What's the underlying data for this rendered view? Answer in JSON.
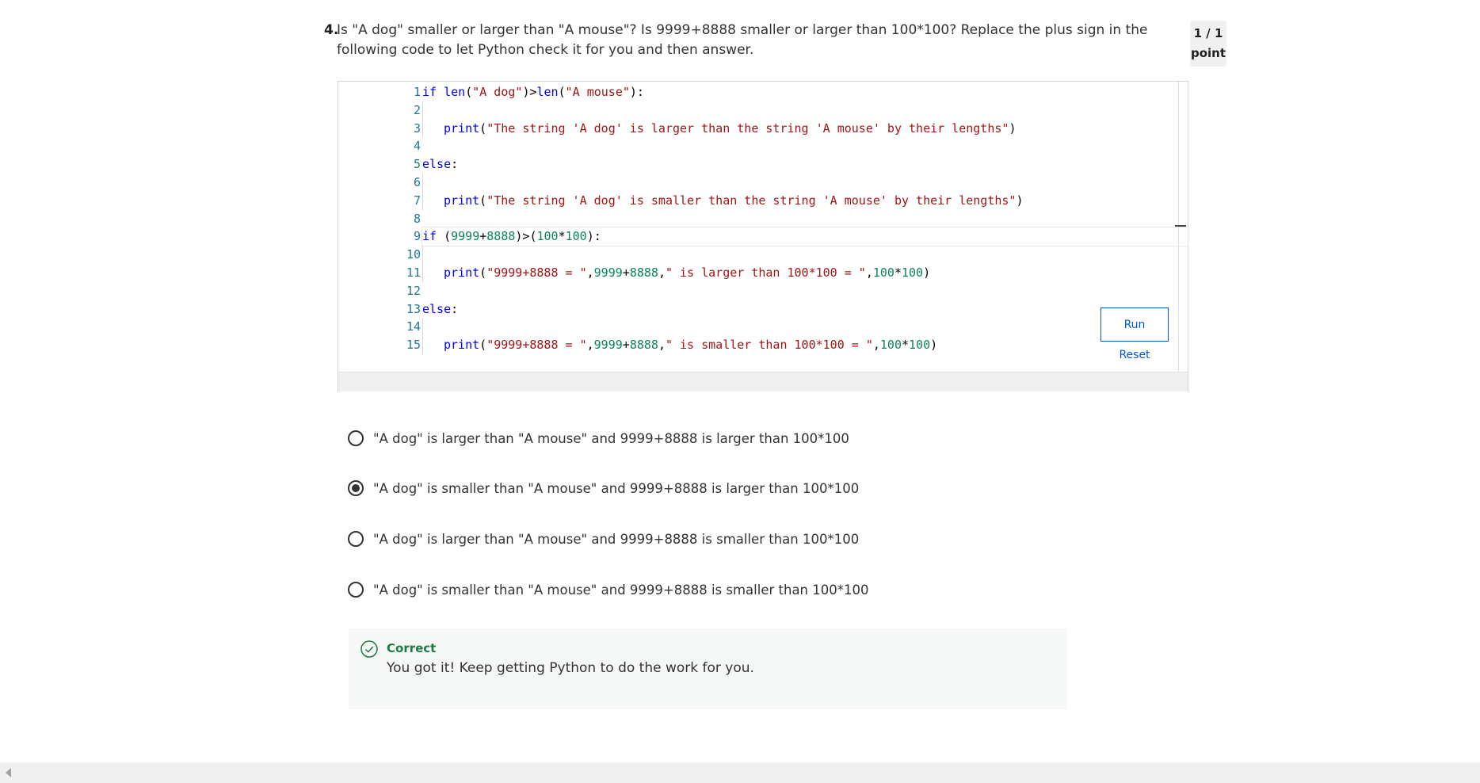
{
  "question": {
    "number": "4.",
    "text": "Is \"A dog\" smaller or larger than \"A mouse\"? Is 9999+8888 smaller or larger than 100*100? Replace the plus sign in the following code to let Python check it for you and then answer.",
    "points_score": "1 / 1",
    "points_label": "point"
  },
  "editor": {
    "line_numbers": [
      "1",
      "2",
      "3",
      "4",
      "5",
      "6",
      "7",
      "8",
      "9",
      "10",
      "11",
      "12",
      "13",
      "14",
      "15"
    ],
    "run_label": "Run",
    "reset_label": "Reset"
  },
  "options": [
    {
      "label": "\"A dog\" is larger than \"A mouse\" and 9999+8888 is larger than 100*100",
      "selected": false
    },
    {
      "label": "\"A dog\" is smaller than \"A mouse\" and 9999+8888 is larger than 100*100",
      "selected": true
    },
    {
      "label": "\"A dog\" is larger than \"A mouse\" and 9999+8888 is smaller than 100*100",
      "selected": false
    },
    {
      "label": "\"A dog\" is smaller than \"A mouse\" and 9999+8888 is smaller than 100*100",
      "selected": false
    }
  ],
  "feedback": {
    "title": "Correct",
    "text": "You got it! Keep getting Python to do the work for you.",
    "color": "#1e7a45"
  },
  "colors": {
    "accent": "#0056d2",
    "keyword": "#0000ff",
    "string": "#a31515",
    "number": "#098658"
  }
}
